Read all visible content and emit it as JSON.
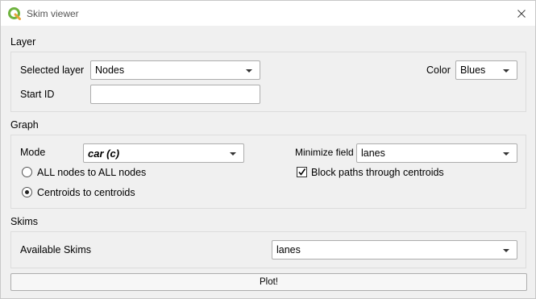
{
  "window": {
    "title": "Skim viewer"
  },
  "layer": {
    "section": "Layer",
    "selected_layer_label": "Selected layer",
    "selected_layer_value": "Nodes",
    "start_id_label": "Start ID",
    "start_id_value": "",
    "color_label": "Color",
    "color_value": "Blues"
  },
  "graph": {
    "section": "Graph",
    "mode_label": "Mode",
    "mode_value": "car (c)",
    "minimize_label": "Minimize field",
    "minimize_value": "lanes",
    "radio_all": "ALL nodes to ALL nodes",
    "radio_centroids": "Centroids to centroids",
    "block_paths": "Block paths through centroids"
  },
  "skims": {
    "section": "Skims",
    "available_label": "Available Skims",
    "available_value": "lanes"
  },
  "plot_button": "Plot!",
  "colors": {
    "qgis_green": "#6fb33f",
    "window_bg": "#f0f0f0"
  }
}
